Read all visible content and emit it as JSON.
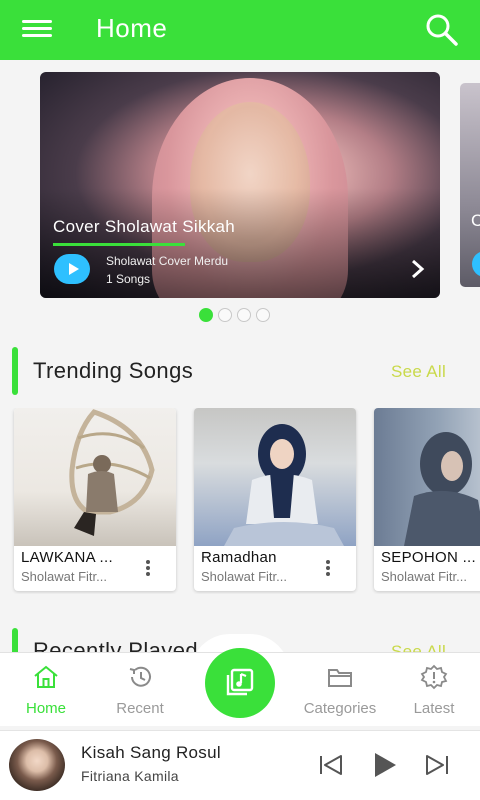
{
  "header": {
    "title": "Home"
  },
  "banner": {
    "title": "Cover Sholawat Sikkah",
    "subtitle": "Sholawat Cover Merdu",
    "count": "1 Songs",
    "peek_letter": "C"
  },
  "carousel": {
    "total": 4,
    "active_index": 0
  },
  "trending": {
    "title": "Trending Songs",
    "see_all": "See All",
    "songs": [
      {
        "name": "LAWKANA ...",
        "artist": "Sholawat Fitr..."
      },
      {
        "name": "Ramadhan",
        "artist": "Sholawat Fitr..."
      },
      {
        "name": "SEPOHON ...",
        "artist": "Sholawat Fitr..."
      }
    ]
  },
  "recent": {
    "title": "Recently Played",
    "see_all": "See All"
  },
  "nav": {
    "items": [
      {
        "label": "Home",
        "icon": "home-icon"
      },
      {
        "label": "Recent",
        "icon": "history-icon"
      },
      {
        "label": "Categories",
        "icon": "folder-icon"
      },
      {
        "label": "Latest",
        "icon": "latest-icon"
      }
    ],
    "center_icon": "music-library-icon"
  },
  "player": {
    "title": "Kisah Sang Rosul",
    "artist": "Fitriana Kamila"
  },
  "colors": {
    "accent": "#3ae03a",
    "see_all": "#c9d94a",
    "play_badge": "#2ec0ff"
  }
}
